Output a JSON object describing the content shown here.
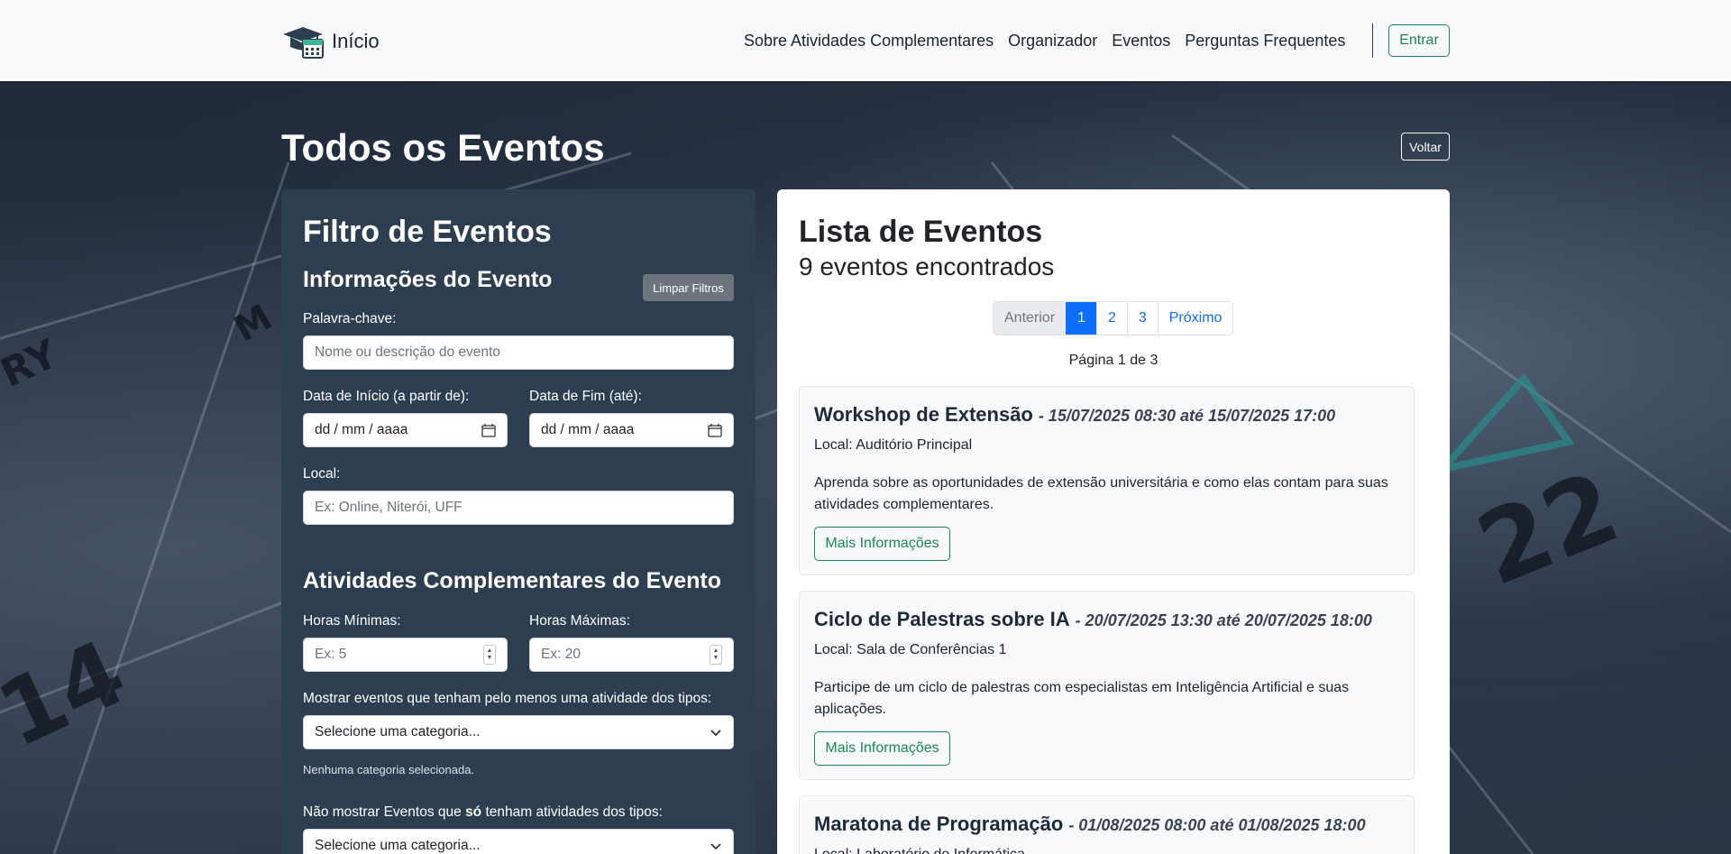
{
  "navbar": {
    "brand": "Início",
    "links": [
      "Sobre Atividades Complementares",
      "Organizador",
      "Eventos",
      "Perguntas Frequentes"
    ],
    "login_label": "Entrar"
  },
  "page": {
    "title": "Todos os Eventos",
    "back_label": "Voltar"
  },
  "filter": {
    "title": "Filtro de Eventos",
    "info_section": "Informações do Evento",
    "clear_label": "Limpar Filtros",
    "keyword_label": "Palavra-chave:",
    "keyword_placeholder": "Nome ou descrição do evento",
    "start_label": "Data de Início (a partir de):",
    "end_label": "Data de Fim (até):",
    "date_format": "dd / mm / aaaa",
    "local_label": "Local:",
    "local_placeholder": "Ex: Online, Niterói, UFF",
    "activities_section": "Atividades Complementares do Evento",
    "min_hours_label": "Horas Mínimas:",
    "min_hours_placeholder": "Ex: 5",
    "max_hours_label": "Horas Máximas:",
    "max_hours_placeholder": "Ex: 20",
    "include_types_label": "Mostrar eventos que tenham pelo menos uma atividade dos tipos:",
    "category_placeholder": "Selecione uma categoria...",
    "none_selected": "Nenhuma categoria selecionada.",
    "exclude_prefix": "Não mostrar Eventos que ",
    "exclude_bold": "só",
    "exclude_suffix": " tenham atividades dos tipos:",
    "exclude_placeholder": "Selecione uma categoria..."
  },
  "list": {
    "title": "Lista de Eventos",
    "count": "9 eventos encontrados",
    "pagination": {
      "prev": "Anterior",
      "pages": [
        "1",
        "2",
        "3"
      ],
      "next": "Próximo"
    },
    "page_info": "Página 1 de 3",
    "more_label": "Mais Informações",
    "events": [
      {
        "name": "Workshop de Extensão",
        "date": "- 15/07/2025 08:30 até 15/07/2025 17:00",
        "local": "Local: Auditório Principal",
        "description": "Aprenda sobre as oportunidades de extensão universitária e como elas contam para suas atividades complementares."
      },
      {
        "name": "Ciclo de Palestras sobre IA",
        "date": "- 20/07/2025 13:30 até 20/07/2025 18:00",
        "local": "Local: Sala de Conferências 1",
        "description": "Participe de um ciclo de palestras com especialistas em Inteligência Artificial e suas aplicações."
      },
      {
        "name": "Maratona de Programação",
        "date": "- 01/08/2025 08:00 até 01/08/2025 18:00",
        "local": "Local: Laboratório de Informática",
        "description": ""
      }
    ]
  }
}
